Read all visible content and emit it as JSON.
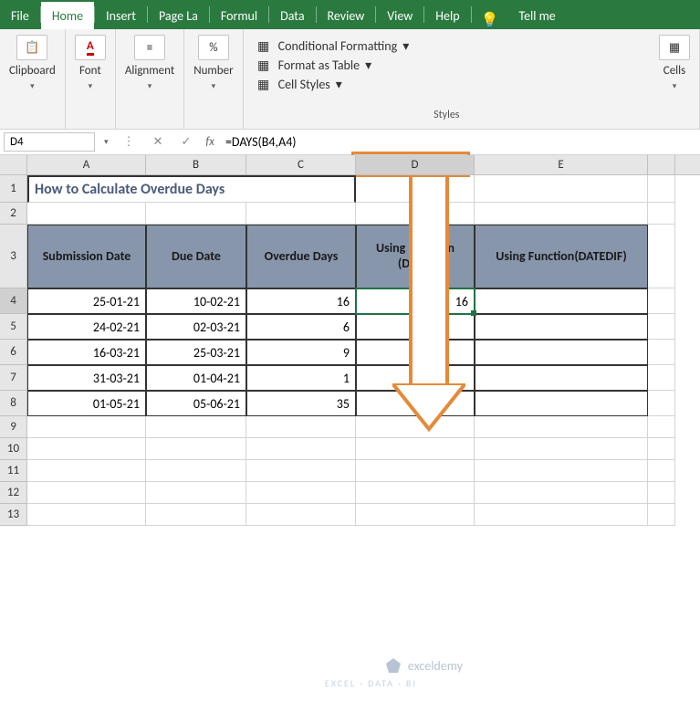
{
  "tabs": [
    "File",
    "Home",
    "Insert",
    "Page La",
    "Formul",
    "Data",
    "Review",
    "View",
    "Help"
  ],
  "active_tab": "Home",
  "tell_me": "Tell me",
  "ribbon": {
    "clipboard": "Clipboard",
    "font": "Font",
    "alignment": "Alignment",
    "number": "Number",
    "cells": "Cells",
    "styles_label": "Styles",
    "cond_fmt": "Conditional Formatting",
    "fmt_table": "Format as Table",
    "cell_styles": "Cell Styles"
  },
  "namebox": "D4",
  "formula": "=DAYS(B4,A4)",
  "columns": [
    "A",
    "B",
    "C",
    "D",
    "E"
  ],
  "title": "How to Calculate Overdue Days",
  "headers": {
    "sub_date": "Submission Date",
    "due_date": "Due Date",
    "overdue": "Overdue Days",
    "fn_days": "Using Function (DAYS)",
    "fn_datedif": "Using Function(DATEDIF)"
  },
  "data_rows": [
    {
      "r": "4",
      "a": "25-01-21",
      "b": "10-02-21",
      "c": "16",
      "d": "16"
    },
    {
      "r": "5",
      "a": "24-02-21",
      "b": "02-03-21",
      "c": "6",
      "d": ""
    },
    {
      "r": "6",
      "a": "16-03-21",
      "b": "25-03-21",
      "c": "9",
      "d": ""
    },
    {
      "r": "7",
      "a": "31-03-21",
      "b": "01-04-21",
      "c": "1",
      "d": ""
    },
    {
      "r": "8",
      "a": "01-05-21",
      "b": "05-06-21",
      "c": "35",
      "d": ""
    }
  ],
  "empty_rows": [
    "9",
    "10",
    "11",
    "12",
    "13"
  ],
  "watermark": "exceldemy",
  "watermark_sub": "EXCEL · DATA · BI"
}
